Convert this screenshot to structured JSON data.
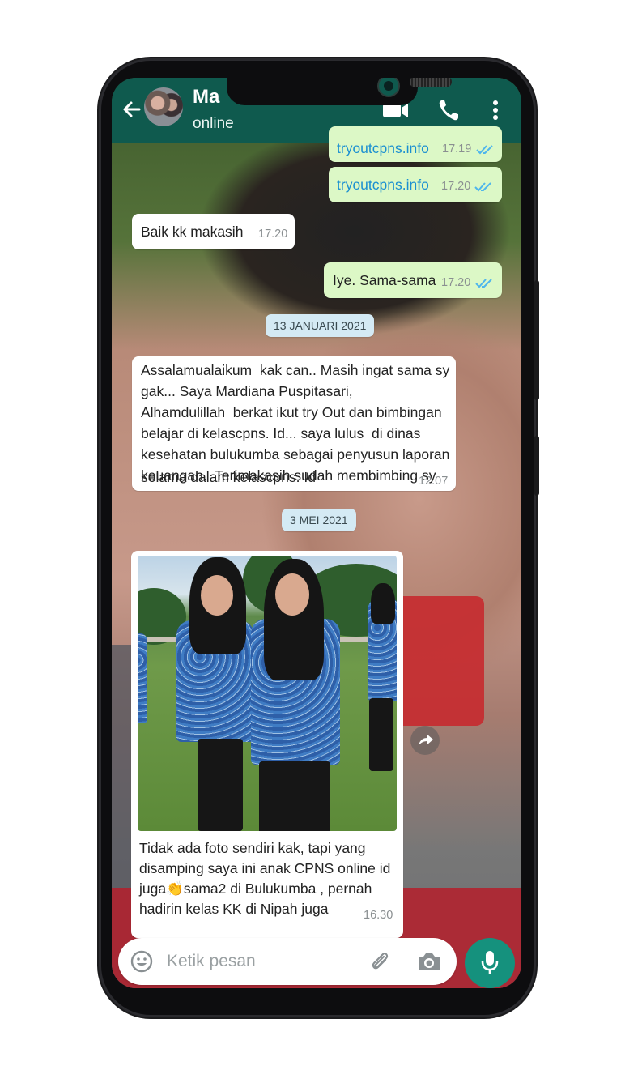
{
  "header": {
    "contact_name": "Ma",
    "status": "online",
    "icons": [
      "back-arrow-icon",
      "video-call-icon",
      "phone-call-icon",
      "more-options-icon"
    ]
  },
  "messages": [
    {
      "direction": "out",
      "text": "tryoutcpns.info",
      "time": "17.19",
      "ticks": "double-blue"
    },
    {
      "direction": "out",
      "text": "tryoutcpns.info",
      "time": "17.20",
      "ticks": "double-blue"
    },
    {
      "direction": "in",
      "text": "Baik kk makasih",
      "time": "17.20"
    },
    {
      "direction": "out",
      "text": "Iye. Sama-sama",
      "time": "17.20",
      "ticks": "double-blue"
    },
    {
      "type": "date",
      "text": "13 JANUARI 2021"
    },
    {
      "direction": "in",
      "lines": [
        "Assalamualaikum  kak can.. Masih ingat sama sy",
        "gak... Saya Mardiana Puspitasari,",
        "Alhamdulillah  berkat ikut try Out dan bimbingan",
        "belajar di kelascpns. Id... saya lulus  di dinas",
        "kesehatan bulukumba sebagai penyusun laporan",
        "keuangan.  Terimakasih sudah membimbing sy",
        "selama dalam kelascpns. Id"
      ],
      "time": "12.07"
    },
    {
      "type": "date",
      "text": "3 MEI 2021"
    },
    {
      "direction": "in",
      "type": "image",
      "caption_lines": [
        "Tidak ada foto sendiri kak, tapi yang",
        "disamping saya ini anak CPNS online id",
        "juga👏sama2 di Bulukumba , pernah",
        "hadirin kelas KK di Nipah juga"
      ],
      "time": "16.30"
    }
  ],
  "input": {
    "placeholder": "Ketik pesan",
    "icons": [
      "emoji-icon",
      "attach-icon",
      "camera-icon",
      "mic-icon"
    ]
  },
  "colors": {
    "header": "#0f5a4e",
    "outgoing_bubble": "#dcf8c6",
    "incoming_bubble": "#ffffff",
    "link": "#1a8fd1",
    "mic_button": "#15917d",
    "tick_read": "#4fb6ec"
  }
}
